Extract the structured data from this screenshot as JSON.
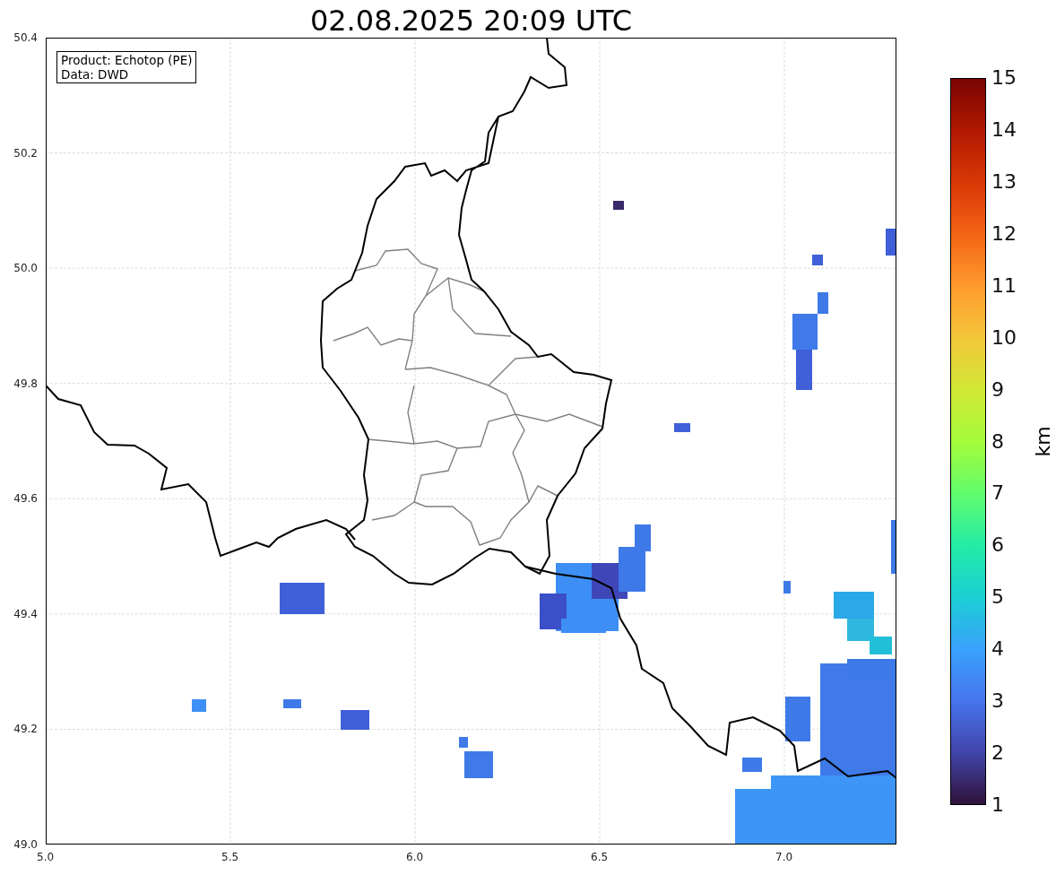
{
  "title": "02.08.2025 20:09 UTC",
  "info_box": [
    "Product: Echotop (PE)",
    "Data: DWD"
  ],
  "x_axis": {
    "ticks": [
      "5.0",
      "5.5",
      "6.0",
      "6.5",
      "7.0"
    ]
  },
  "y_axis": {
    "ticks": [
      "50.4",
      "50.2",
      "50.0",
      "49.8",
      "49.6",
      "49.4",
      "49.2",
      "49.0"
    ]
  },
  "colorbar": {
    "label": "km",
    "ticks": [
      "15",
      "14",
      "13",
      "12",
      "11",
      "10",
      "9",
      "8",
      "7",
      "6",
      "5",
      "4",
      "3",
      "2",
      "1"
    ]
  }
}
